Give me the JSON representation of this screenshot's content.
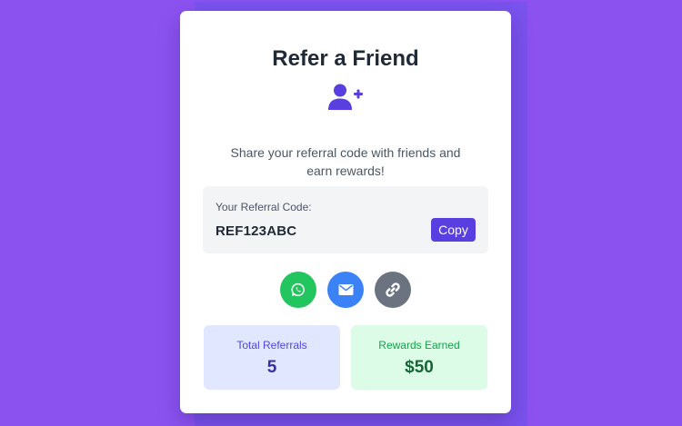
{
  "card": {
    "title": "Refer a Friend",
    "hero_icon": "user-plus-icon",
    "description": "Share your referral code with friends and earn rewards!"
  },
  "referral": {
    "label": "Your Referral Code:",
    "code": "REF123ABC",
    "copy_label": "Copy"
  },
  "share_buttons": [
    {
      "icon": "whatsapp-icon",
      "color": "#22c55e"
    },
    {
      "icon": "envelope-icon",
      "color": "#3b82f6"
    },
    {
      "icon": "link-icon",
      "color": "#6b7280"
    }
  ],
  "stats": {
    "total_referrals": {
      "label": "Total Referrals",
      "value": "5",
      "background": "#e0e7ff",
      "label_color": "#4f46e5",
      "value_color": "#3730a3"
    },
    "rewards_earned": {
      "label": "Rewards Earned",
      "value": "$50",
      "background": "#dcfce7",
      "label_color": "#16a34a",
      "value_color": "#166534"
    }
  },
  "colors": {
    "page_background": "#8b52f0",
    "card_background": "#ffffff",
    "accent": "#5a3fe0"
  }
}
